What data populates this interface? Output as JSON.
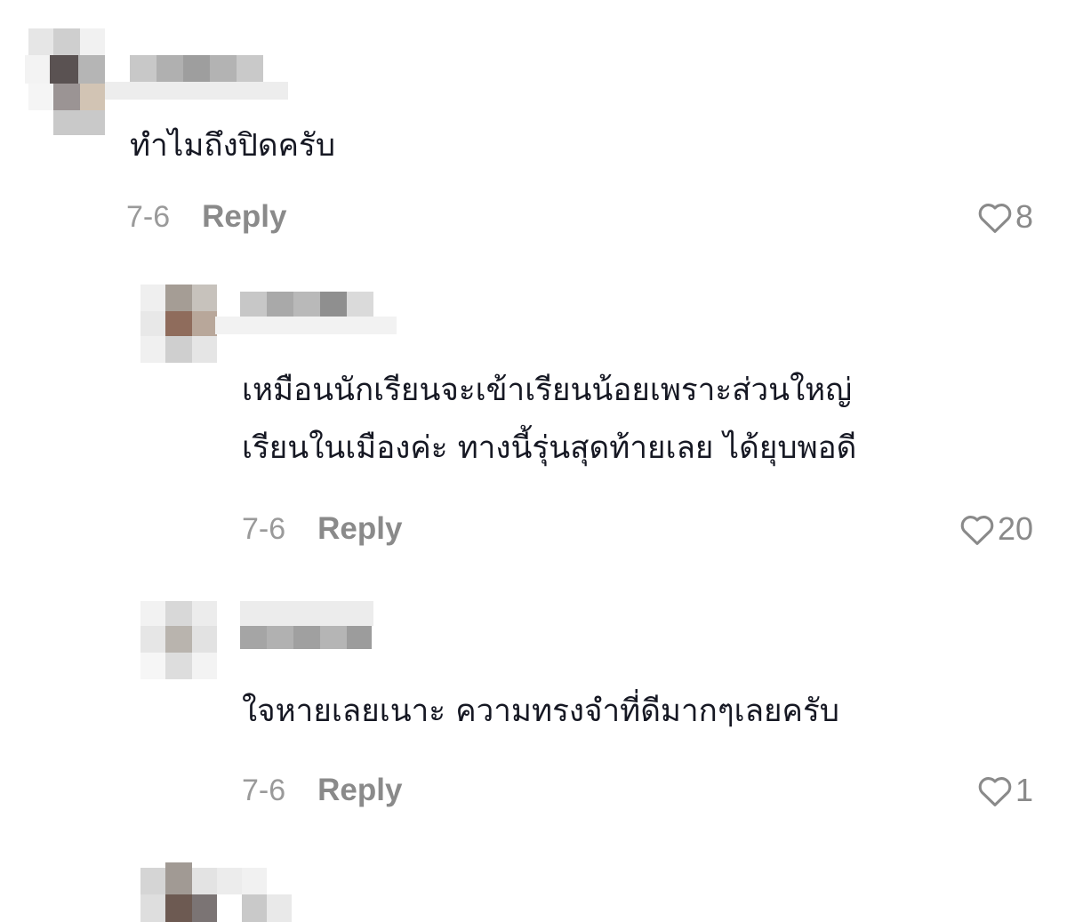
{
  "comments": [
    {
      "text": "ทำไมถึงปิดครับ",
      "date": "7-6",
      "reply_label": "Reply",
      "likes": "8",
      "avatar_colors": [
        "#e6e6e6",
        "#cfcfcf",
        "#f1f1f1",
        "#5a5252",
        "#b5b5b5",
        "#f3f3f3",
        "#9b9494",
        "#d2c4b4",
        "#f5f5f5",
        "#c9c9c9"
      ],
      "name_colors": [
        "#c8c8c8",
        "#b0b0b0",
        "#9e9e9e",
        "#b3b3b3",
        "#c9c9c9",
        "#ededed"
      ]
    },
    {
      "text_lines": [
        "เหมือนนักเรียนจะเข้าเรียนน้อยเพราะส่วนใหญ่",
        "เรียนในเมืองค่ะ ทางนี้รุ่นสุดท้ายเลย ได้ยุบพอดี"
      ],
      "date": "7-6",
      "reply_label": "Reply",
      "likes": "20",
      "avatar_colors": [
        "#efefef",
        "#a59d95",
        "#c7c2bc",
        "#e8e8e8",
        "#8f6c5c",
        "#b8a79a",
        "#f0f0f0",
        "#cfcfcf",
        "#e5e5e5"
      ],
      "name_colors": [
        "#c7c7c7",
        "#a9a9a9",
        "#b9b9b9",
        "#8f8f8f",
        "#dadada",
        "#f2f2f2"
      ]
    },
    {
      "text": "ใจหายเลยเนาะ ความทรงจำที่ดีมากๆเลยครับ",
      "date": "7-6",
      "reply_label": "Reply",
      "likes": "1",
      "avatar_colors": [
        "#f2f2f2",
        "#d8d8d8",
        "#ececec",
        "#e6e6e6",
        "#b9b4ae",
        "#e2e2e2",
        "#f6f6f6",
        "#dddddd",
        "#f3f3f3"
      ],
      "name_colors": [
        "#a5a5a5",
        "#b1b1b1",
        "#a0a0a0",
        "#b5b5b5",
        "#9c9c9c",
        "#ececec"
      ]
    },
    {
      "avatar_colors": [
        "#d5d5d5",
        "#a19a94",
        "#e3e3e3",
        "#ececec",
        "#f1f1f1",
        "#6d5a52",
        "#7b7474",
        "#dedede",
        "#c9c9c9",
        "#e9e9e9"
      ]
    }
  ],
  "icons": {
    "heart": "heart-outline-icon"
  }
}
